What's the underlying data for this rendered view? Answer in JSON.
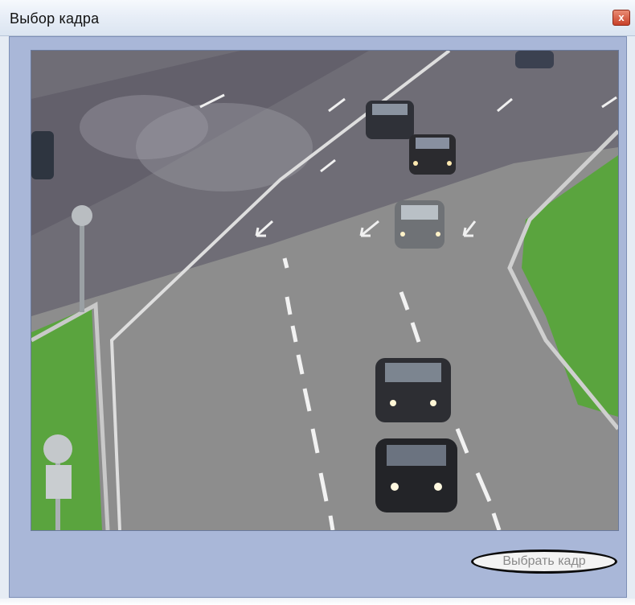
{
  "window": {
    "title": "Выбор кадра",
    "close_glyph": "x"
  },
  "video": {
    "description_icon": "camera-frame"
  },
  "actions": {
    "select_frame_label": "Выбрать кадр"
  },
  "colors": {
    "frame_bg": "#a9b7d8",
    "titlebar": "#e8eef7",
    "close_button": "#c8412a",
    "road": "#8f8f8f",
    "grass": "#5aa43e"
  }
}
